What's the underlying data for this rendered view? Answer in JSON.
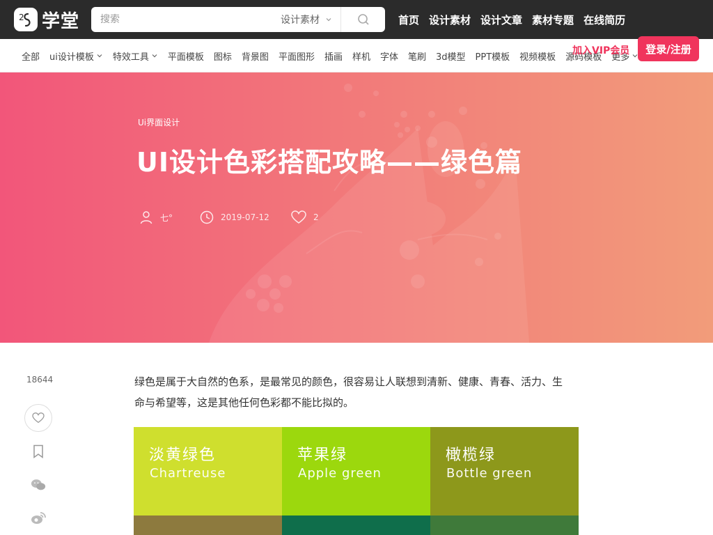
{
  "header": {
    "logo_text": "学堂",
    "logo_mark": "2S",
    "search": {
      "placeholder": "搜索",
      "category": "设计素材"
    },
    "nav": [
      "首页",
      "设计素材",
      "设计文章",
      "素材专题",
      "在线简历"
    ],
    "vip": "加入VIP会员",
    "login": "登录/注册"
  },
  "categories": [
    {
      "label": "全部",
      "dropdown": false
    },
    {
      "label": "ui设计模板",
      "dropdown": true
    },
    {
      "label": "特效工具",
      "dropdown": true
    },
    {
      "label": "平面模板",
      "dropdown": false
    },
    {
      "label": "图标",
      "dropdown": false
    },
    {
      "label": "背景图",
      "dropdown": false
    },
    {
      "label": "平面图形",
      "dropdown": false
    },
    {
      "label": "插画",
      "dropdown": false
    },
    {
      "label": "样机",
      "dropdown": false
    },
    {
      "label": "字体",
      "dropdown": false
    },
    {
      "label": "笔刷",
      "dropdown": false
    },
    {
      "label": "3d模型",
      "dropdown": false
    },
    {
      "label": "PPT模板",
      "dropdown": false
    },
    {
      "label": "视频模板",
      "dropdown": false
    },
    {
      "label": "源码模板",
      "dropdown": false
    },
    {
      "label": "更多",
      "dropdown": true
    }
  ],
  "article": {
    "category": "Ui界面设计",
    "title": "UI设计色彩搭配攻略——绿色篇",
    "author": "七°",
    "date": "2019-07-12",
    "likes": "2",
    "views": "18644",
    "paragraph": "绿色是属于大自然的色系，是最常见的颜色，很容易让人联想到清新、健康、青春、活力、生命与希望等，这是其他任何色彩都不能比拟的。"
  },
  "swatches": [
    {
      "cn": "淡黄绿色",
      "en": "Chartreuse",
      "color": "#cfdf2e"
    },
    {
      "cn": "苹果绿",
      "en": "Apple green",
      "color": "#9cd80d"
    },
    {
      "cn": "橄榄绿",
      "en": "Bottle green",
      "color": "#8d981b"
    },
    {
      "cn": "",
      "en": "",
      "color": "#8d7a3e"
    },
    {
      "cn": "",
      "en": "",
      "color": "#0f6e4b"
    },
    {
      "cn": "",
      "en": "",
      "color": "#3f7a3a"
    }
  ],
  "colors": {
    "accent": "#f0345c",
    "topbar": "#2b2b2b",
    "hero_start": "#f2567a",
    "hero_end": "#f29c7a"
  }
}
